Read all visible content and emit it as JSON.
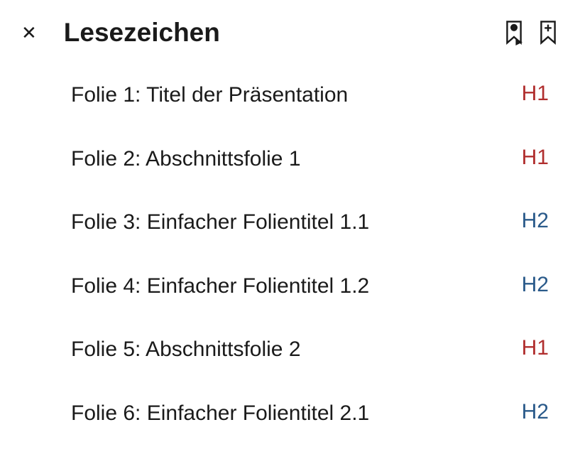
{
  "header": {
    "title": "Lesezeichen"
  },
  "bookmarks": [
    {
      "label": "Folie 1: Titel der Präsentation",
      "level": "H1"
    },
    {
      "label": "Folie 2: Abschnittsfolie 1",
      "level": "H1"
    },
    {
      "label": "Folie 3: Einfacher Folientitel 1.1",
      "level": "H2"
    },
    {
      "label": "Folie 4: Einfacher Folientitel 1.2",
      "level": "H2"
    },
    {
      "label": "Folie 5: Abschnittsfolie 2",
      "level": "H1"
    },
    {
      "label": "Folie 6: Einfacher Folientitel 2.1",
      "level": "H2"
    }
  ]
}
